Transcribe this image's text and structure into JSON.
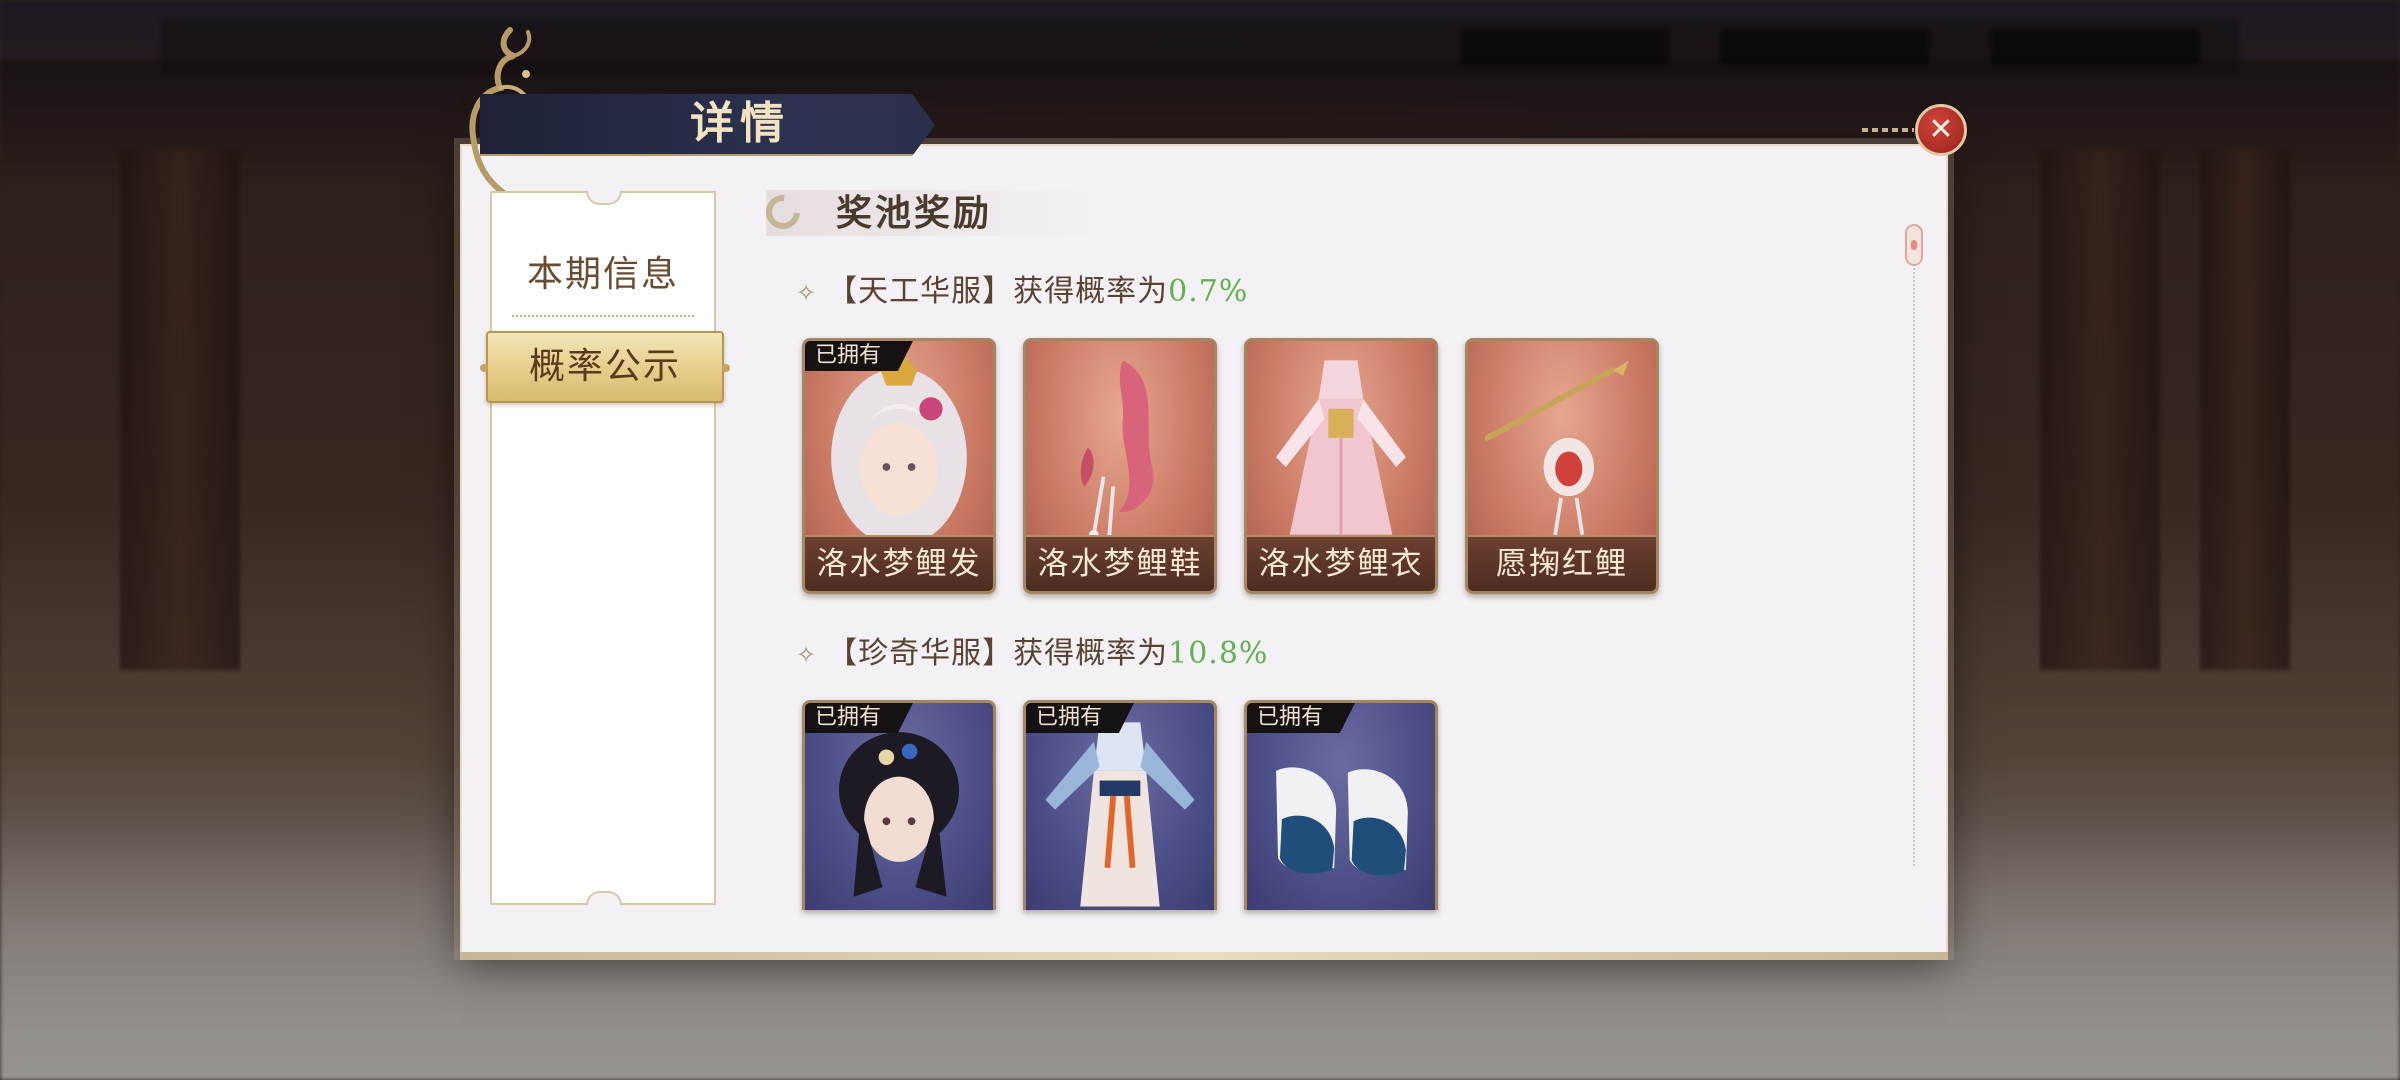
{
  "dialog": {
    "title": "详情",
    "close_icon": "close-icon"
  },
  "nav": {
    "items": [
      {
        "label": "本期信息",
        "active": false
      },
      {
        "label": "概率公示",
        "active": true
      }
    ]
  },
  "section": {
    "title": "奖池奖励"
  },
  "groups": [
    {
      "bracket_open": "【",
      "name": "天工华服",
      "bracket_close": "】",
      "rate_text": "获得概率为",
      "rate": "0.7%",
      "items": [
        {
          "label": "洛水梦鲤发",
          "owned": true,
          "owned_text": "已拥有",
          "icon": "hair-icon"
        },
        {
          "label": "洛水梦鲤鞋",
          "owned": false,
          "icon": "shoes-icon"
        },
        {
          "label": "洛水梦鲤衣",
          "owned": false,
          "icon": "dress-icon"
        },
        {
          "label": "愿掬红鲤",
          "owned": false,
          "icon": "accessory-icon"
        }
      ]
    },
    {
      "bracket_open": "【",
      "name": "珍奇华服",
      "bracket_close": "】",
      "rate_text": "获得概率为",
      "rate": "10.8%",
      "items": [
        {
          "label": "",
          "owned": true,
          "owned_text": "已拥有",
          "icon": "hair-icon"
        },
        {
          "label": "",
          "owned": true,
          "owned_text": "已拥有",
          "icon": "dress-icon"
        },
        {
          "label": "",
          "owned": true,
          "owned_text": "已拥有",
          "icon": "shoes-icon"
        }
      ]
    }
  ],
  "colors": {
    "rate_green": "#5fb34c",
    "title_gold": "#f3e3c0",
    "close_red": "#c23a32"
  }
}
